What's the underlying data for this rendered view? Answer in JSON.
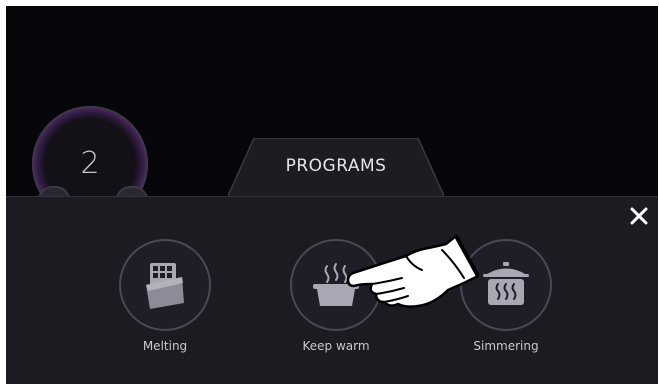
{
  "knob": {
    "value": "2"
  },
  "tab": {
    "label": "PROGRAMS"
  },
  "panel": {
    "close_icon": "close-icon",
    "programs": [
      {
        "label": "Melting",
        "icon": "chocolate-icon"
      },
      {
        "label": "Keep warm",
        "icon": "warm-pot-icon"
      },
      {
        "label": "Simmering",
        "icon": "simmering-pot-icon"
      }
    ]
  },
  "colors": {
    "background": "#07060a",
    "panel": "#1c1b22",
    "icon_bg": "#9b99a6",
    "text": "#e6e4ea"
  }
}
